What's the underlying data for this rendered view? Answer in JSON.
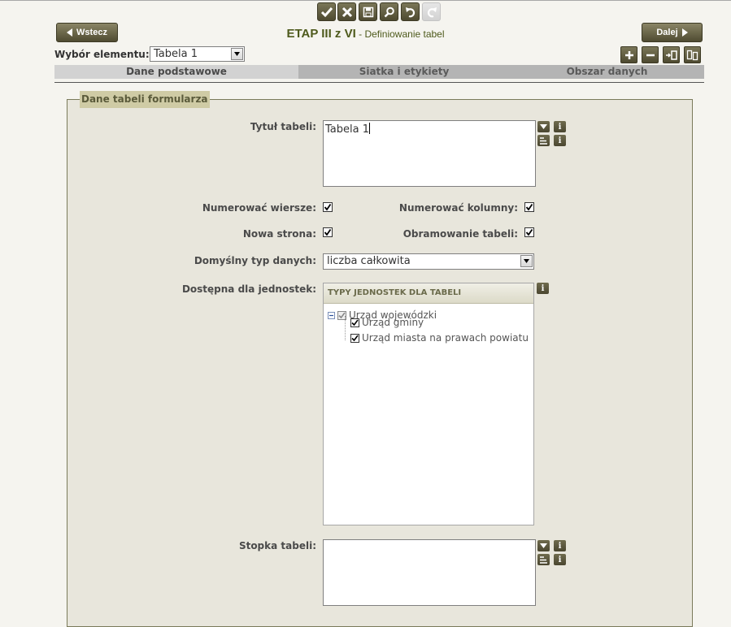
{
  "toolbar": {
    "buttons": [
      "Zatwierdź",
      "Anuluj",
      "Zapisz",
      "Podgląd",
      "Cofnij",
      "Ponów"
    ]
  },
  "nav": {
    "back_label": "Wstecz",
    "next_label": "Dalej"
  },
  "heading": {
    "main": "ETAP III z VI",
    "sub": " - Definiowanie tabel"
  },
  "element_select": {
    "label": "Wybór elementu:",
    "value": "Tabela 1"
  },
  "tabs": [
    "Dane podstawowe",
    "Siatka i etykiety",
    "Obszar danych"
  ],
  "form": {
    "legend": "Dane tabeli formularza",
    "title_label": "Tytuł tabeli:",
    "title_value": "Tabela 1",
    "number_rows_label": "Numerować wiersze:",
    "number_cols_label": "Numerować kolumny:",
    "new_page_label": "Nowa strona:",
    "border_label": "Obramowanie tabeli:",
    "datatype_label": "Domyślny typ danych:",
    "datatype_value": "liczba całkowita",
    "units_label": "Dostępna dla jednostek:",
    "footer_label": "Stopka tabeli:",
    "footer_value": ""
  },
  "tree": {
    "header": "TYPY JEDNOSTEK DLA TABELI",
    "root": "Urząd wojewódzki",
    "children": [
      "Urząd gminy",
      "Urząd miasta na prawach powiatu"
    ]
  },
  "colors": {
    "accent": "#4e5a1c",
    "button": "#5a5638",
    "panel": "#e8e6dc",
    "legend_bg": "#cfcba5"
  }
}
